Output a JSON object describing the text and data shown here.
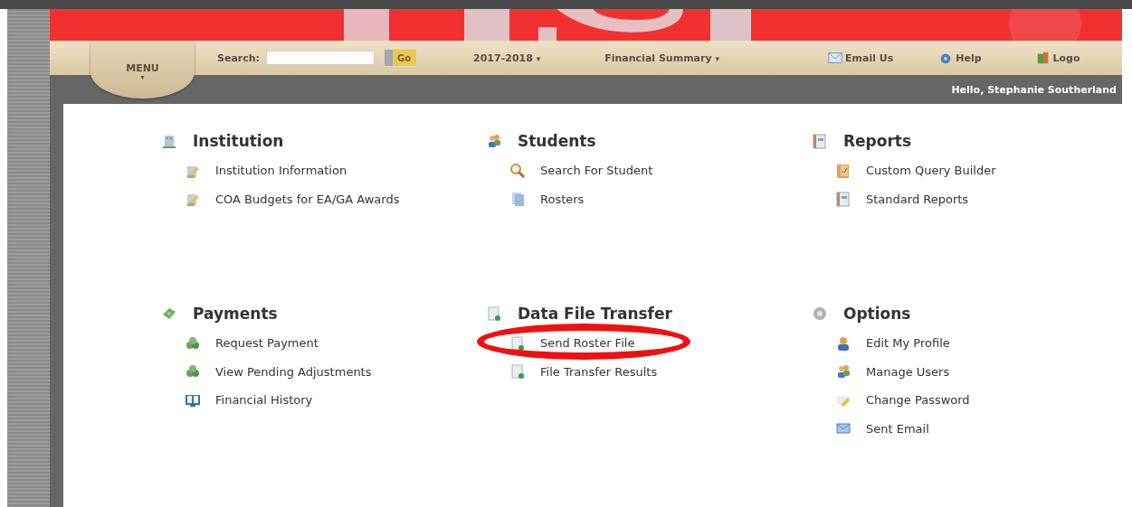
{
  "header": {
    "menu": {
      "label": "MENU",
      "caret": "▾"
    },
    "search": {
      "label": "Search:",
      "button": "Go"
    },
    "dropdowns": [
      {
        "label": "2017-2018",
        "caret": "▾"
      },
      {
        "label": "Financial Summary",
        "caret": "▾"
      }
    ],
    "links": [
      {
        "kind": "email",
        "label": "Email Us"
      },
      {
        "kind": "help",
        "label": "Help"
      },
      {
        "kind": "logout",
        "label": "Logo"
      }
    ],
    "greeting": "Hello, Stephanie Southerland"
  },
  "sections": [
    {
      "title": "Institution",
      "items": [
        {
          "label": "Institution Information",
          "highlighted": false
        },
        {
          "label": "COA Budgets for EA/GA Awards",
          "highlighted": false
        }
      ]
    },
    {
      "title": "Students",
      "items": [
        {
          "label": "Search For Student",
          "highlighted": false
        },
        {
          "label": "Rosters",
          "highlighted": false
        }
      ]
    },
    {
      "title": "Reports",
      "items": [
        {
          "label": "Custom Query Builder",
          "highlighted": false
        },
        {
          "label": "Standard Reports",
          "highlighted": false
        }
      ]
    },
    {
      "title": "Payments",
      "items": [
        {
          "label": "Request Payment",
          "highlighted": false
        },
        {
          "label": "View Pending Adjustments",
          "highlighted": false
        },
        {
          "label": "Financial History",
          "highlighted": false
        }
      ]
    },
    {
      "title": "Data File Transfer",
      "items": [
        {
          "label": "Send Roster File",
          "highlighted": true
        },
        {
          "label": "File Transfer Results",
          "highlighted": false
        }
      ]
    },
    {
      "title": "Options",
      "items": [
        {
          "label": "Edit My Profile",
          "highlighted": false
        },
        {
          "label": "Manage Users",
          "highlighted": false
        },
        {
          "label": "Change Password",
          "highlighted": false
        },
        {
          "label": "Sent Email",
          "highlighted": false
        }
      ]
    }
  ]
}
